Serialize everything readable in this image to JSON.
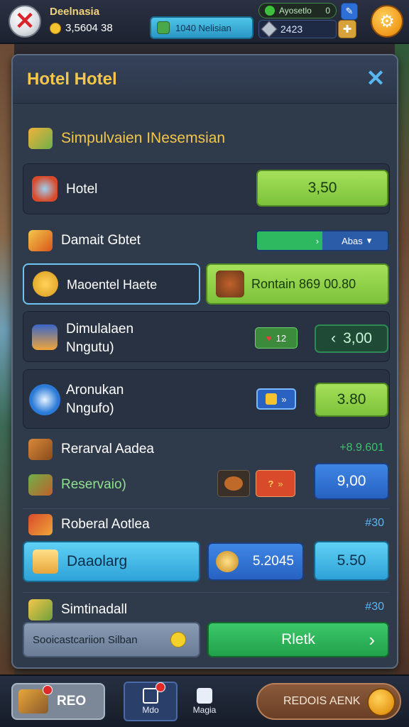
{
  "topbar": {
    "player_name": "Deelnasia",
    "coins": "3,5604 38",
    "resource_label": "1040 Nelisian",
    "green_pill": "Ayosetlo",
    "green_pill_value": "0",
    "gems": "2423"
  },
  "panel": {
    "title": "Hotel Hotel",
    "sections": [
      {
        "title": "Simpulvaien INesemsian"
      },
      {
        "title": "Rerarval Aadea",
        "price": "+8.9.601"
      },
      {
        "title": "Roberal Aotlea",
        "price": "#30"
      },
      {
        "title": "Simtinadall",
        "price": "#30"
      }
    ],
    "rows": {
      "hotel": {
        "label": "Hotel",
        "button": "3,50"
      },
      "domain": {
        "label": "Damait Gbtet",
        "chip_text": "Abas"
      },
      "moment": {
        "label": "Maoentel Haete",
        "button": "Rontain 869   00.80"
      },
      "simulation": {
        "label1": "Dimulalaen",
        "label2": "Nngutu)",
        "chip": "12",
        "button": "3,00"
      },
      "aronukan": {
        "label1": "Aronukan",
        "label2": "Nngufo)",
        "button": "3.80"
      },
      "reservation": {
        "label": "Reservaio)",
        "button": "9,00"
      },
      "daaolarg": {
        "label": "Daaolarg",
        "value": "5.2045",
        "button": "5.50"
      },
      "final": {
        "label": "Sooicastcariion Silban",
        "button": "Rletk"
      }
    }
  },
  "bottombar": {
    "left_label": "REO",
    "tab1": "Mdo",
    "tab2": "Magia",
    "right_label": "REDOIS AENK"
  },
  "colors": {
    "accent_gold": "#f4c74a",
    "accent_blue": "#58b6f0",
    "lime": "#8fd14a",
    "green": "#2bb456"
  }
}
